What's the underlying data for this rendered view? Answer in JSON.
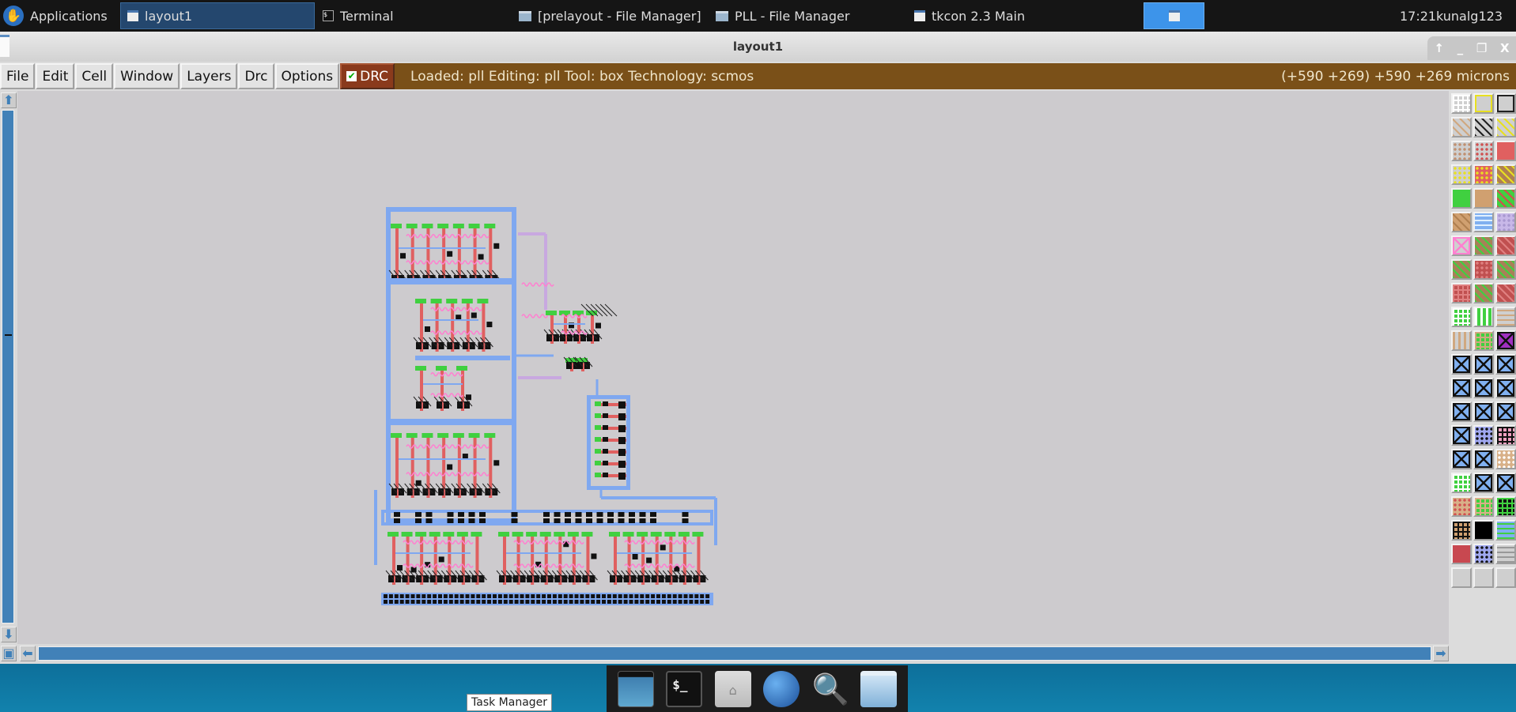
{
  "taskbar": {
    "applications_label": "Applications",
    "tasks": [
      {
        "label": "layout1",
        "icon": "window-icon",
        "active": true
      },
      {
        "label": "Terminal",
        "icon": "terminal-icon"
      },
      {
        "label": "[prelayout - File Manager]",
        "icon": "folder-icon"
      },
      {
        "label": "PLL - File Manager",
        "icon": "folder-icon"
      },
      {
        "label": "tkcon 2.3 Main",
        "icon": "window-icon"
      }
    ],
    "clock": "17:21",
    "user": "kunalg123"
  },
  "window": {
    "title": "layout1"
  },
  "menubar": {
    "items": [
      "File",
      "Edit",
      "Cell",
      "Window",
      "Layers",
      "Drc",
      "Options"
    ],
    "drc_label": "DRC",
    "drc_checked": true,
    "status": "Loaded: pll Editing: pll Tool: box  Technology: scmos",
    "coords": "(+590 +269) +590 +269 microns"
  },
  "colors": {
    "status_bg": "#7a5018",
    "drc_bg": "#8a3a1c",
    "scroll": "#4181b8",
    "canvas": "#cdcbce",
    "metal1": "#7fa8f0",
    "poly": "#e06060",
    "diff": "#40d040",
    "contact": "#111111",
    "metal2": "#ff80d0",
    "metal3": "#c8a8e0"
  },
  "palette": {
    "tiles": [
      [
        "#cfcfcf",
        "#ffffff",
        "grid"
      ],
      [
        "#cfcfcf",
        "#e8e020",
        "outline"
      ],
      [
        "#cfcfcf",
        "#222222",
        "outline"
      ],
      [
        "#cfcfcf",
        "#d0a880",
        "diag"
      ],
      [
        "#cfcfcf",
        "#222222",
        "diag"
      ],
      [
        "#cfcfcf",
        "#e8e020",
        "diag"
      ],
      [
        "#cfcfcf",
        "#c09070",
        "dots"
      ],
      [
        "#cfcfcf",
        "#d05050",
        "dots"
      ],
      [
        "#e06060",
        "#e06060",
        "solid"
      ],
      [
        "#cfcfcf",
        "#e8e020",
        "dots"
      ],
      [
        "#e06060",
        "#e8e020",
        "dots"
      ],
      [
        "#b08050",
        "#e8e020",
        "diag"
      ],
      [
        "#40d040",
        "#40d040",
        "solid"
      ],
      [
        "#d0a070",
        "#d0a070",
        "solid"
      ],
      [
        "#40d040",
        "#d05050",
        "diag"
      ],
      [
        "#d0a070",
        "#b08050",
        "diag"
      ],
      [
        "#80b0f0",
        "#e0f0ff",
        "hlines"
      ],
      [
        "#c8b8e8",
        "#a898d0",
        "dots"
      ],
      [
        "#cfcfcf",
        "#ff80d0",
        "x"
      ],
      [
        "#a88058",
        "#40d040",
        "diag"
      ],
      [
        "#c05050",
        "#e08080",
        "diag"
      ],
      [
        "#a88058",
        "#40d040",
        "diag"
      ],
      [
        "#c05050",
        "#e08080",
        "dots"
      ],
      [
        "#a88058",
        "#40d040",
        "diag"
      ],
      [
        "#c05050",
        "#e08080",
        "grid"
      ],
      [
        "#a88058",
        "#40d040",
        "diag"
      ],
      [
        "#c05050",
        "#e08080",
        "diag"
      ],
      [
        "#40d040",
        "#ffffff",
        "grid"
      ],
      [
        "#40d040",
        "#ffffff",
        "vlines"
      ],
      [
        "#cfcfcf",
        "#d0a880",
        "hlines"
      ],
      [
        "#cfcfcf",
        "#d0a880",
        "vlines"
      ],
      [
        "#40d040",
        "#d0a880",
        "grid"
      ],
      [
        "#a030c0",
        "#111111",
        "x"
      ],
      [
        "#80b0f0",
        "#111111",
        "x"
      ],
      [
        "#80b0f0",
        "#111111",
        "x"
      ],
      [
        "#80b0f0",
        "#111111",
        "x"
      ],
      [
        "#80b0f0",
        "#111111",
        "x"
      ],
      [
        "#80b0f0",
        "#111111",
        "x"
      ],
      [
        "#80b0f0",
        "#111111",
        "x"
      ],
      [
        "#80b0f0",
        "#111111",
        "x"
      ],
      [
        "#80b0f0",
        "#111111",
        "x"
      ],
      [
        "#80b0f0",
        "#111111",
        "x"
      ],
      [
        "#80b0f0",
        "#111111",
        "x"
      ],
      [
        "#a0a8f0",
        "#111111",
        "dots"
      ],
      [
        "#f0a0c0",
        "#111111",
        "grid"
      ],
      [
        "#80b0f0",
        "#111111",
        "x"
      ],
      [
        "#80b0f0",
        "#111111",
        "x"
      ],
      [
        "#d8b088",
        "#ffffff",
        "dots"
      ],
      [
        "#40d040",
        "#ffffff",
        "grid"
      ],
      [
        "#80b0f0",
        "#111111",
        "x"
      ],
      [
        "#80b0f0",
        "#111111",
        "x"
      ],
      [
        "#d8b088",
        "#d05050",
        "dots"
      ],
      [
        "#40d040",
        "#d8b088",
        "grid"
      ],
      [
        "#111111",
        "#40d040",
        "grid"
      ],
      [
        "#d0a070",
        "#111111",
        "grid"
      ],
      [
        "#000000",
        "#000000",
        "solid"
      ],
      [
        "#80b0f0",
        "#40d040",
        "hlines"
      ],
      [
        "#c84850",
        "#c84850",
        "solid"
      ],
      [
        "#a0a8f0",
        "#111111",
        "dots"
      ],
      [
        "#cfcfcf",
        "#999999",
        "hlines"
      ],
      [
        "#cfcfcf",
        "#cfcfcf",
        "solid"
      ],
      [
        "#cfcfcf",
        "#cfcfcf",
        "solid"
      ],
      [
        "#cfcfcf",
        "#cfcfcf",
        "solid"
      ]
    ]
  },
  "dock": {
    "items": [
      "task-manager",
      "terminal",
      "home-folder",
      "web-browser",
      "search",
      "files"
    ],
    "tooltip": "Task Manager"
  }
}
